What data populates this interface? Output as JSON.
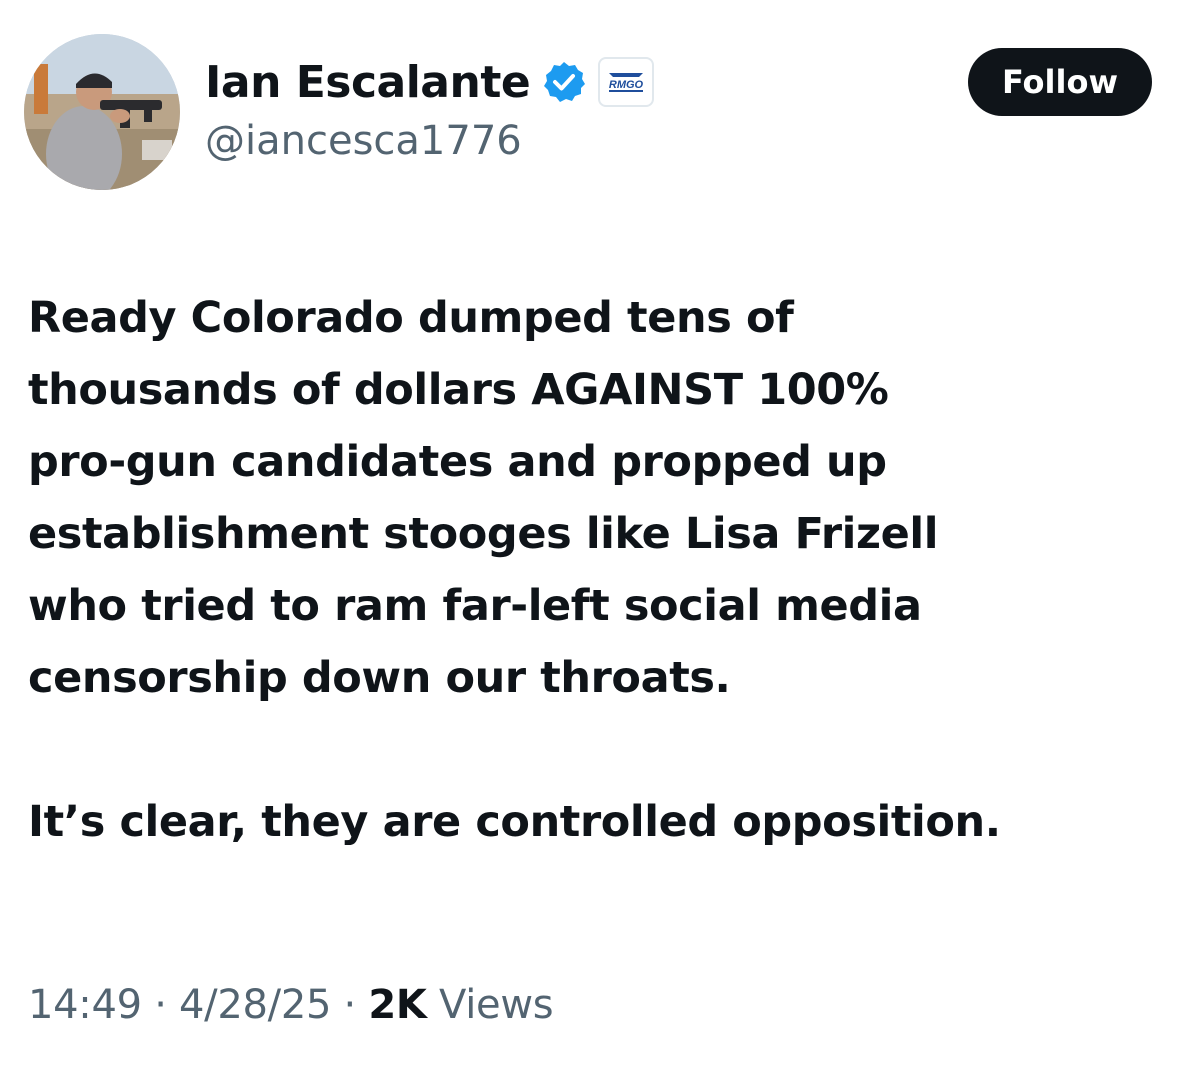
{
  "author": {
    "name": "Ian Escalante",
    "handle": "@iancesca1776",
    "affiliate_badge_text": "RMGO"
  },
  "follow_button": {
    "label": "Follow"
  },
  "tweet": {
    "lines": [
      "Ready Colorado dumped tens of",
      "thousands of dollars AGAINST 100%",
      "pro-gun candidates and propped up",
      "establishment stooges like Lisa Frizell",
      "who tried to ram far-left social media",
      "censorship down our throats."
    ],
    "closing_line": "It’s clear, they are controlled opposition."
  },
  "meta": {
    "time": "14:49",
    "separator": " · ",
    "date": "4/28/25",
    "views_count": "2K",
    "views_label": " Views"
  },
  "colors": {
    "text": "#0f1419",
    "secondary": "#536471",
    "verified": "#1d9bf0",
    "button_bg": "#0f1419"
  },
  "icons": [
    "verified-badge-icon",
    "affiliate-badge-icon",
    "avatar-image"
  ]
}
